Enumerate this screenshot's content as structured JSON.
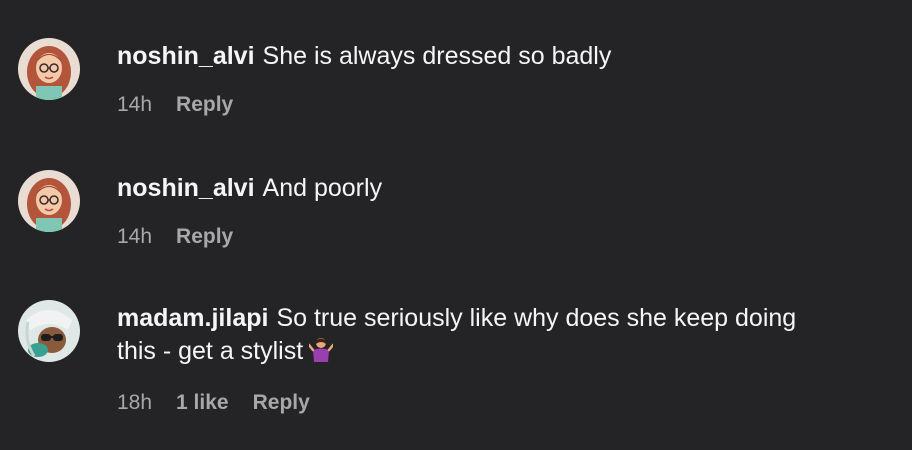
{
  "comments": [
    {
      "username": "noshin_alvi",
      "text": "She is always dressed so badly",
      "time": "14h",
      "likes": "",
      "reply_label": "Reply",
      "avatar_icon": "cartoon-woman-with-glasses-avatar"
    },
    {
      "username": "noshin_alvi",
      "text": "And poorly",
      "time": "14h",
      "likes": "",
      "reply_label": "Reply",
      "avatar_icon": "cartoon-woman-with-glasses-avatar"
    },
    {
      "username": "madam.jilapi",
      "text_line1": "So true seriously like why does she keep doing",
      "text_line2": "this - get a stylist",
      "emoji": "person-shrugging-emoji",
      "time": "18h",
      "likes": "1 like",
      "reply_label": "Reply",
      "avatar_icon": "cartoon-person-with-sunglasses-avatar"
    }
  ],
  "colors": {
    "background": "#242427",
    "primary_text": "#f5f5f5",
    "secondary_text": "#a8a8a8"
  }
}
